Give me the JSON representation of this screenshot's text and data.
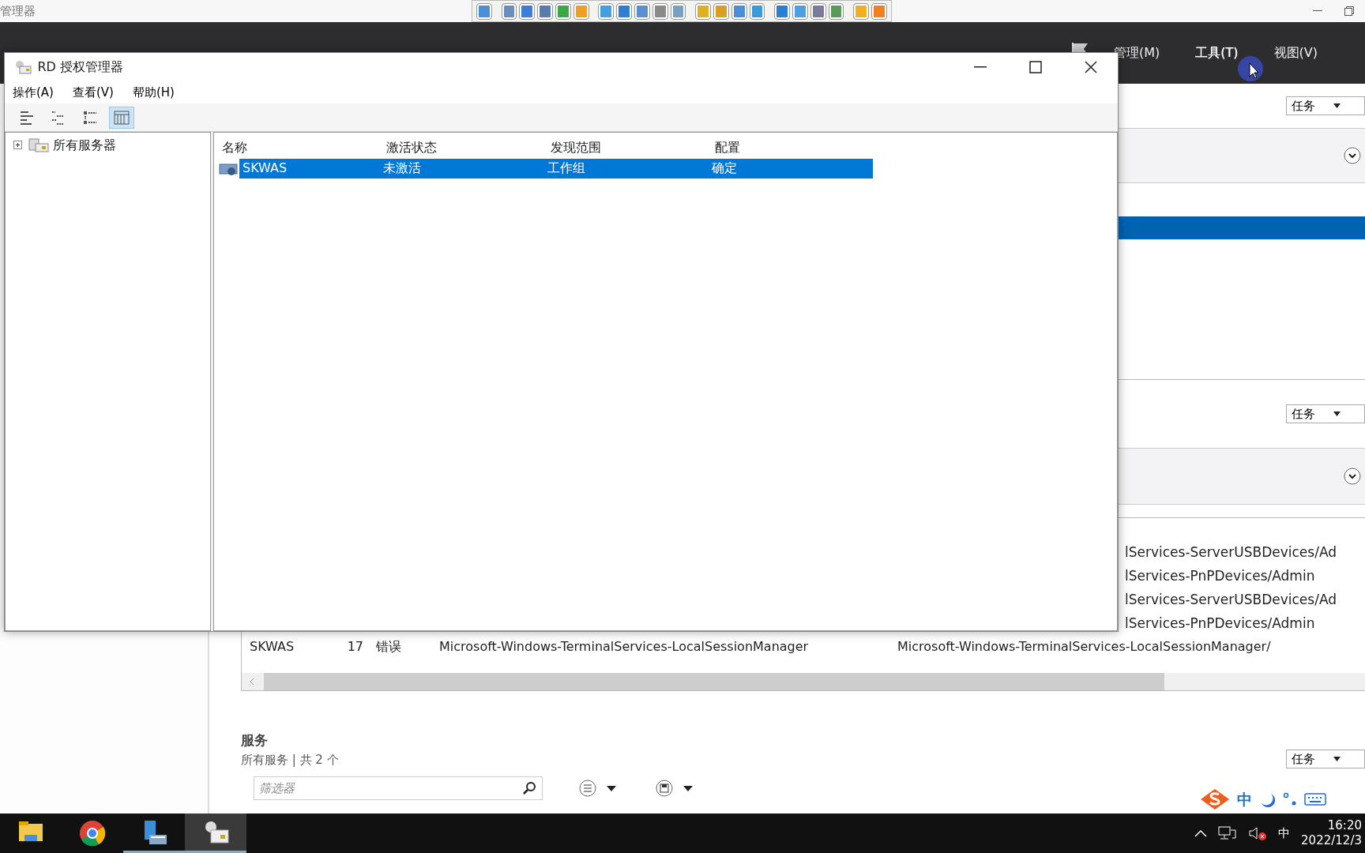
{
  "background": {
    "title": "管理器",
    "menu": [
      {
        "label": "管理(M)",
        "selected": false
      },
      {
        "label": "工具(T)",
        "selected": true
      },
      {
        "label": "视图(V)",
        "selected": false
      }
    ],
    "panel_1": {
      "task_button": "任务",
      "rows": [
        {
          "selected": true
        }
      ]
    },
    "panel_2": {
      "task_button": "任务",
      "log_lines": [
        "lServices-ServerUSBDevices/Ad",
        "lServices-PnPDevices/Admin",
        "lServices-ServerUSBDevices/Ad",
        "lServices-PnPDevices/Admin"
      ],
      "events": [
        {
          "server": "SKWAS",
          "id": "17",
          "level": "错误",
          "source": "Microsoft-Windows-TerminalServices-LocalSessionManager",
          "log": "Microsoft-Windows-TerminalServices-LocalSessionManager/"
        }
      ]
    },
    "services": {
      "title": "服务",
      "subtitle": "所有服务 | 共 2 个",
      "task_button": "任务",
      "filter": {
        "placeholder": "筛选器"
      }
    }
  },
  "dialog": {
    "title": "RD 授权管理器",
    "menu": [
      "操作(A)",
      "查看(V)",
      "帮助(H)"
    ],
    "toolbar": [
      {
        "selected": false
      },
      {
        "selected": false
      },
      {
        "selected": false
      },
      {
        "selected": true
      }
    ],
    "tree": [
      {
        "label": "所有服务器",
        "expanded": false
      }
    ],
    "columns": [
      "名称",
      "激活状态",
      "发现范围",
      "配置"
    ],
    "rows": [
      {
        "cells": [
          "SKWAS",
          "未激活",
          "工作组",
          "确定"
        ],
        "selected": true
      }
    ]
  },
  "ime": {
    "mode": "中"
  },
  "taskbar": {
    "apps": [
      {
        "open": false,
        "active": false
      },
      {
        "open": false,
        "active": false
      },
      {
        "open": true,
        "active": false
      },
      {
        "open": true,
        "active": true
      }
    ],
    "language": "中",
    "time": "16:20",
    "date": "2022/12/3"
  }
}
